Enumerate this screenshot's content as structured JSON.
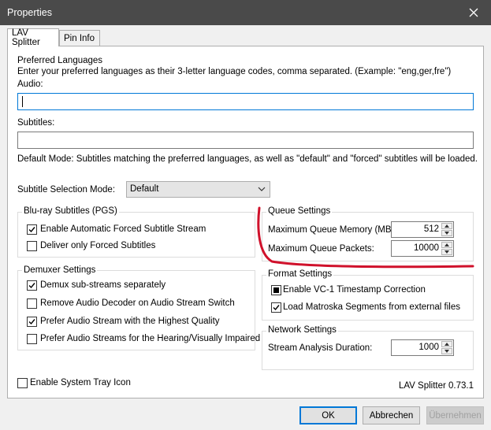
{
  "window": {
    "title": "Properties"
  },
  "tabs": [
    {
      "label": "LAV Splitter"
    },
    {
      "label": "Pin Info"
    }
  ],
  "languages": {
    "heading": "Preferred Languages",
    "description": "Enter your preferred languages as their 3-letter language codes, comma separated. (Example: \"eng,ger,fre\")",
    "audio_label": "Audio:",
    "audio_value": "",
    "subtitles_label": "Subtitles:",
    "subtitles_value": "",
    "mode_note": "Default Mode: Subtitles matching the preferred languages, as well as \"default\" and \"forced\" subtitles will be loaded.",
    "selection_mode_label": "Subtitle Selection Mode:",
    "selection_mode_value": "Default"
  },
  "bluray": {
    "title": "Blu-ray Subtitles (PGS)",
    "items": [
      {
        "label": "Enable Automatic Forced Subtitle Stream",
        "checked": true
      },
      {
        "label": "Deliver only Forced Subtitles",
        "checked": false
      }
    ]
  },
  "demuxer": {
    "title": "Demuxer Settings",
    "items": [
      {
        "label": "Demux sub-streams separately",
        "checked": true
      },
      {
        "label": "Remove Audio Decoder on Audio Stream Switch",
        "checked": false
      },
      {
        "label": "Prefer Audio Stream with the Highest Quality",
        "checked": true
      },
      {
        "label": "Prefer Audio Streams for the Hearing/Visually Impaired",
        "checked": false
      }
    ]
  },
  "queue": {
    "title": "Queue Settings",
    "memory_label": "Maximum Queue Memory (MB):",
    "memory_value": "512",
    "packets_label": "Maximum Queue Packets:",
    "packets_value": "10000"
  },
  "format": {
    "title": "Format Settings",
    "items": [
      {
        "label": "Enable VC-1 Timestamp Correction",
        "state": "indeterminate"
      },
      {
        "label": "Load Matroska Segments from external files",
        "state": "checked"
      }
    ]
  },
  "network": {
    "title": "Network Settings",
    "duration_label": "Stream Analysis Duration:",
    "duration_value": "1000"
  },
  "tray": {
    "label": "Enable System Tray Icon",
    "checked": false
  },
  "version": "LAV Splitter 0.73.1",
  "buttons": {
    "ok": "OK",
    "cancel": "Abbrechen",
    "apply": "Übernehmen"
  },
  "colors": {
    "annotation": "#d0112b",
    "focus": "#0078d7",
    "titlebar": "#4a4a4a"
  }
}
